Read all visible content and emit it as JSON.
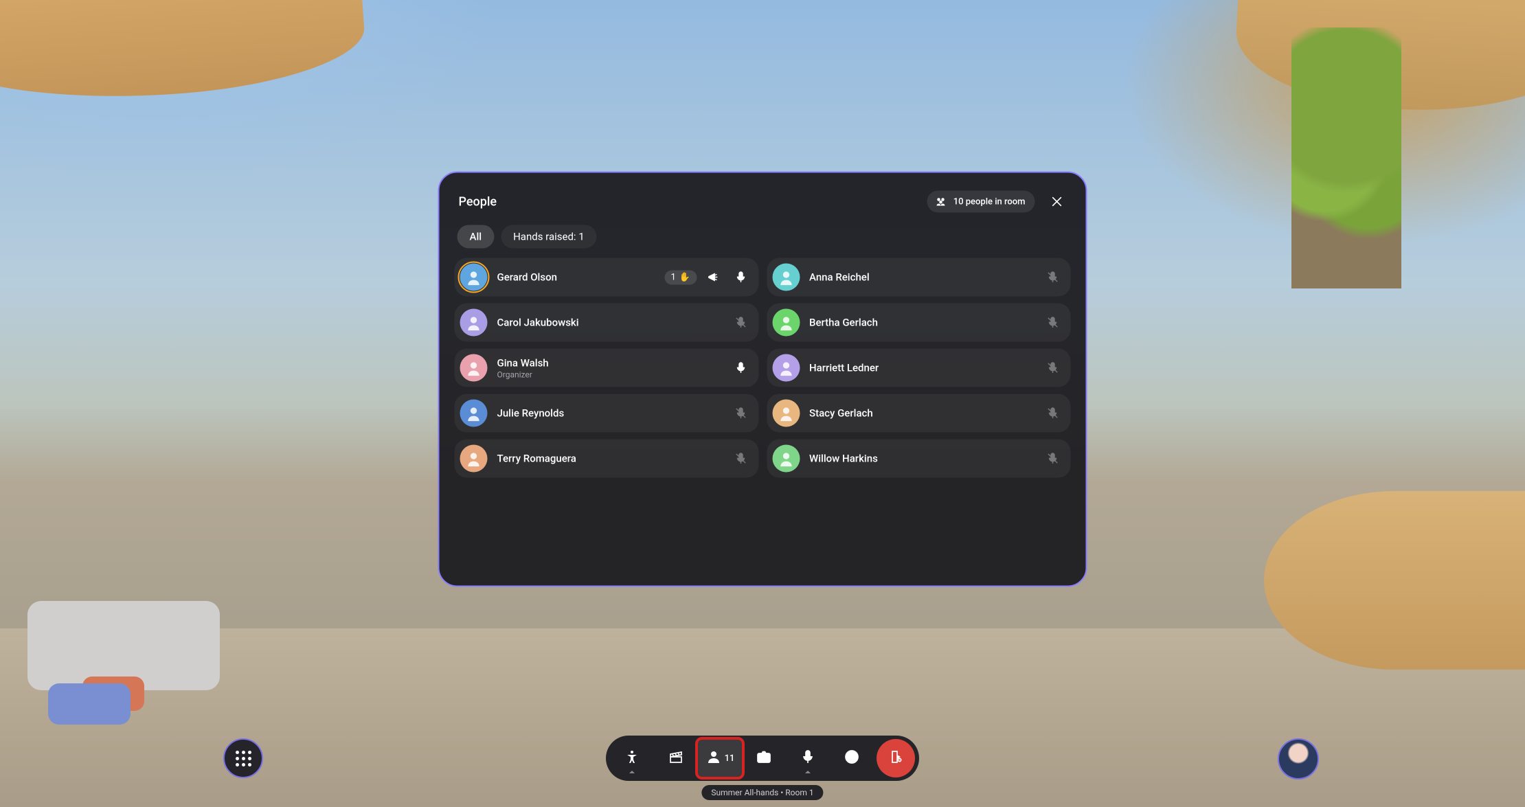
{
  "panel": {
    "title": "People",
    "room_count_label": "10 people in room"
  },
  "tabs": {
    "all": "All",
    "hands_raised": "Hands raised: 1"
  },
  "people_left": [
    {
      "name": "Gerard Olson",
      "sub": "",
      "badge_num": "1",
      "badge_emoji": "✋",
      "megaphone": true,
      "mic": "on",
      "avatar_bg": "#5fa6e0",
      "ring": true
    },
    {
      "name": "Carol Jakubowski",
      "sub": "",
      "mic": "muted",
      "avatar_bg": "#a99ee6"
    },
    {
      "name": "Gina Walsh",
      "sub": "Organizer",
      "mic": "on",
      "avatar_bg": "#e8a1ad"
    },
    {
      "name": "Julie Reynolds",
      "sub": "",
      "mic": "muted",
      "avatar_bg": "#5a8dd6"
    },
    {
      "name": "Terry Romaguera",
      "sub": "",
      "mic": "muted",
      "avatar_bg": "#e7a87f"
    }
  ],
  "people_right": [
    {
      "name": "Anna Reichel",
      "sub": "",
      "mic": "muted",
      "avatar_bg": "#66d0d0"
    },
    {
      "name": "Bertha Gerlach",
      "sub": "",
      "mic": "muted",
      "avatar_bg": "#6bd46b"
    },
    {
      "name": "Harriett Ledner",
      "sub": "",
      "mic": "muted",
      "avatar_bg": "#b3a0e8"
    },
    {
      "name": "Stacy Gerlach",
      "sub": "",
      "mic": "muted",
      "avatar_bg": "#e8b67f"
    },
    {
      "name": "Willow Harkins",
      "sub": "",
      "mic": "muted",
      "avatar_bg": "#7fd68a"
    }
  ],
  "toolbar": {
    "people_count": "11"
  },
  "session": {
    "label": "Summer All-hands • Room 1"
  }
}
